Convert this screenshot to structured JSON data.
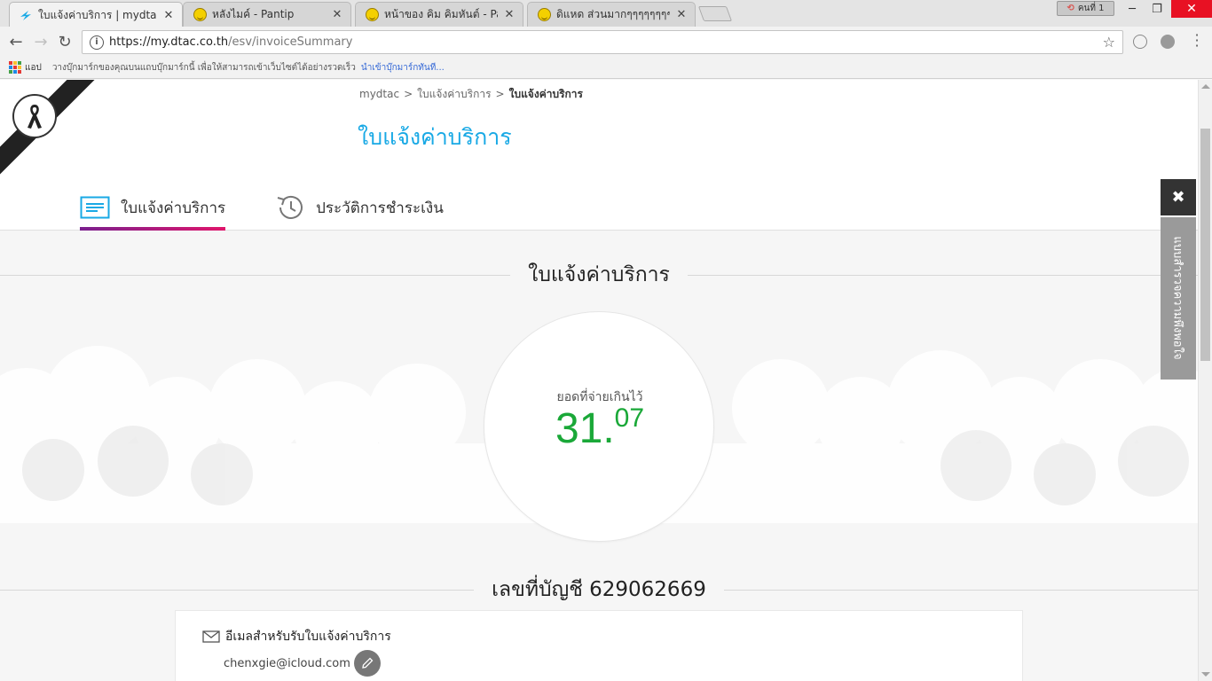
{
  "browser": {
    "tabs": [
      {
        "title": "ใบแจ้งค่าบริการ | mydtac",
        "icon": "dtac-icon",
        "active": true
      },
      {
        "title": "หลังไมค์ - Pantip",
        "icon": "pantip-icon",
        "active": false
      },
      {
        "title": "หน้าของ คิม คิมหันต์ - Pantip",
        "icon": "pantip-icon",
        "active": false
      },
      {
        "title": "ดิแหด ส่วนมากๆๆๆๆๆๆๆๆๆๆๆๆ",
        "icon": "pantip-icon",
        "active": false
      }
    ],
    "profile_label": "คนที่ 1",
    "url_host": "https://my.dtac.co.th",
    "url_path": "/esv/invoiceSummary",
    "bookmarks": {
      "apps_label": "แอป",
      "hint": "วางบุ๊กมาร์กของคุณบนแถบบุ๊กมาร์กนี้ เพื่อให้สามารถเข้าเว็บไซต์ได้อย่างรวดเร็ว",
      "import_link": "นำเข้าบุ๊กมาร์กทันที..."
    }
  },
  "page": {
    "breadcrumb": [
      "mydtac",
      "ใบแจ้งค่าบริการ",
      "ใบแจ้งค่าบริการ"
    ],
    "breadcrumb_sep": ">",
    "title": "ใบแจ้งค่าบริการ",
    "tabs": [
      {
        "label": "ใบแจ้งค่าบริการ",
        "icon": "invoice-icon",
        "active": true
      },
      {
        "label": "ประวัติการชำระเงิน",
        "icon": "history-icon",
        "active": false
      }
    ],
    "invoice_heading": "ใบแจ้งค่าบริการ",
    "balance": {
      "label": "ยอดที่จ่ายเกินไว้",
      "integer": "31.",
      "decimal": "07",
      "color": "#1aa838"
    },
    "account_heading": "เลขที่บัญชี 629062669",
    "email_section": {
      "title": "อีเมลสำหรับรับใบแจ้งค่าบริการ",
      "email": "chenxgie@icloud.com"
    },
    "side_panel": {
      "close_symbol": "✖",
      "survey_label": "แบบสำรวจความพึงพอใจ"
    },
    "colors": {
      "title_blue": "#19a9e5",
      "tab_gradient_start": "#7a1f8e",
      "tab_gradient_end": "#e0156b"
    }
  }
}
